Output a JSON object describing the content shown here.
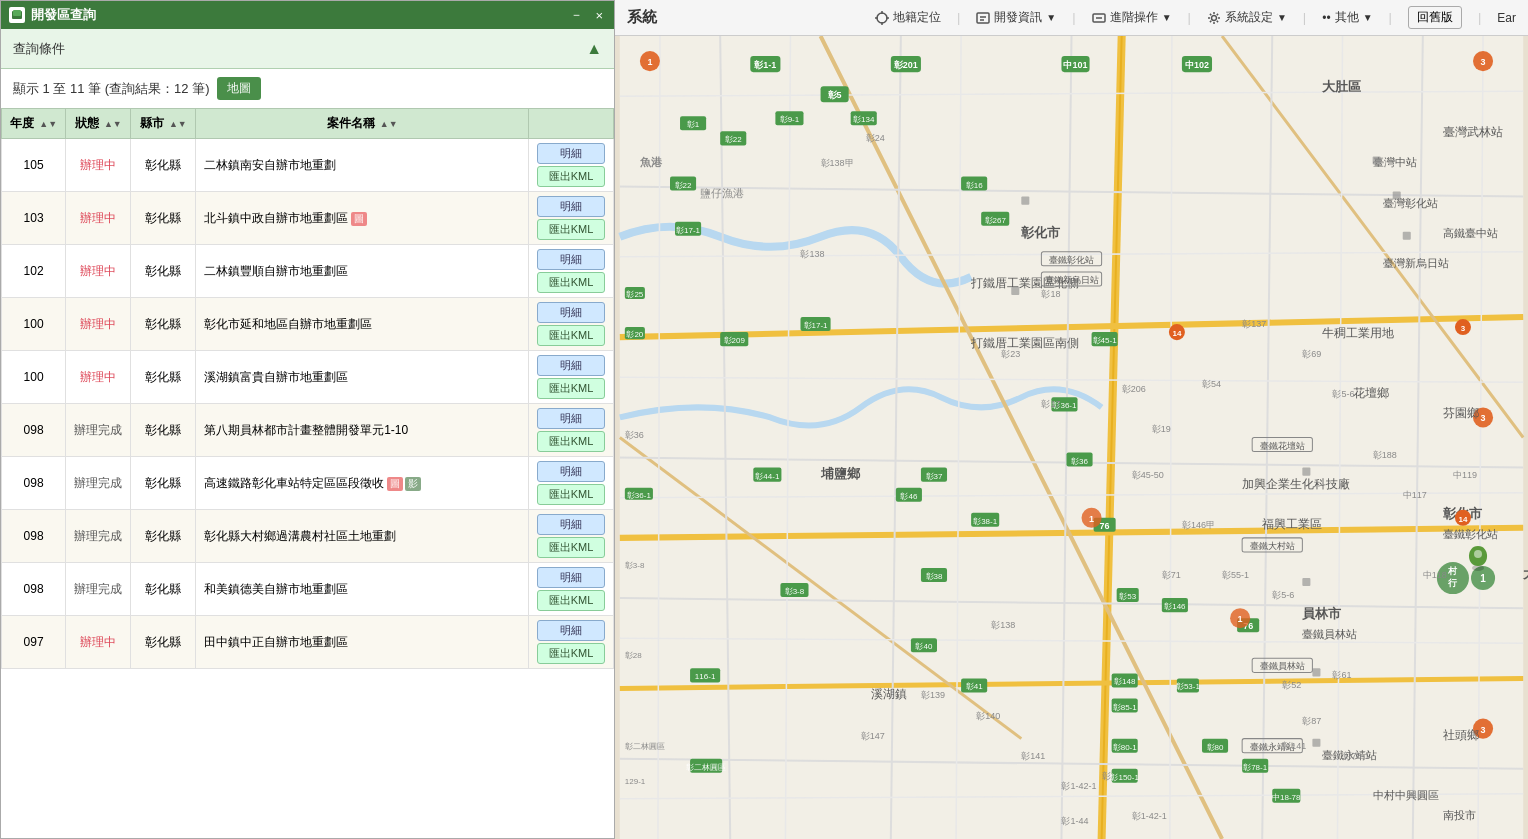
{
  "app": {
    "title": "開發區查詢",
    "minimize_label": "－",
    "close_label": "×"
  },
  "query_bar": {
    "label": "查詢條件",
    "toggle_icon": "▲"
  },
  "results": {
    "summary": "顯示 1 至 11 筆 (查詢結果：12 筆)",
    "map_btn": "地圖"
  },
  "table": {
    "headers": [
      {
        "label": "年度",
        "sortable": true
      },
      {
        "label": "狀態",
        "sortable": true
      },
      {
        "label": "縣市",
        "sortable": true
      },
      {
        "label": "案件名稱",
        "sortable": true
      }
    ],
    "rows": [
      {
        "year": "105",
        "status": "辦理中",
        "status_type": "doing",
        "county": "彰化縣",
        "name": "二林鎮南安自辦市地重劃",
        "has_badge": false,
        "badge_type": null,
        "detail_btn": "明細",
        "kml_btn": "匯出KML"
      },
      {
        "year": "103",
        "status": "辦理中",
        "status_type": "doing",
        "county": "彰化縣",
        "name": "北斗鎮中政自辦市地重劃區",
        "has_badge": true,
        "badge_type": "red",
        "detail_btn": "明細",
        "kml_btn": "匯出KML"
      },
      {
        "year": "102",
        "status": "辦理中",
        "status_type": "doing",
        "county": "彰化縣",
        "name": "二林鎮豐順自辦市地重劃區",
        "has_badge": false,
        "badge_type": null,
        "detail_btn": "明細",
        "kml_btn": "匯出KML"
      },
      {
        "year": "100",
        "status": "辦理中",
        "status_type": "doing",
        "county": "彰化縣",
        "name": "彰化市延和地區自辦市地重劃區",
        "has_badge": false,
        "badge_type": null,
        "detail_btn": "明細",
        "kml_btn": "匯出KML"
      },
      {
        "year": "100",
        "status": "辦理中",
        "status_type": "doing",
        "county": "彰化縣",
        "name": "溪湖鎮富貴自辦市地重劃區",
        "has_badge": false,
        "badge_type": null,
        "detail_btn": "明細",
        "kml_btn": "匯出KML"
      },
      {
        "year": "098",
        "status": "辦理完成",
        "status_type": "done",
        "county": "彰化縣",
        "name": "第八期員林都市計畫整體開發單元1-10",
        "has_badge": false,
        "badge_type": null,
        "detail_btn": "明細",
        "kml_btn": "匯出KML"
      },
      {
        "year": "098",
        "status": "辦理完成",
        "status_type": "done",
        "county": "彰化縣",
        "name": "高速鐵路彰化車站特定區區段徵收",
        "has_badge": true,
        "badge_type": "double",
        "detail_btn": "明細",
        "kml_btn": "匯出KML"
      },
      {
        "year": "098",
        "status": "辦理完成",
        "status_type": "done",
        "county": "彰化縣",
        "name": "彰化縣大村鄉過溝農村社區土地重劃",
        "has_badge": false,
        "badge_type": null,
        "detail_btn": "明細",
        "kml_btn": "匯出KML"
      },
      {
        "year": "098",
        "status": "辦理完成",
        "status_type": "done",
        "county": "彰化縣",
        "name": "和美鎮德美自辦市地重劃區",
        "has_badge": false,
        "badge_type": null,
        "detail_btn": "明細",
        "kml_btn": "匯出KML"
      },
      {
        "year": "097",
        "status": "辦理中",
        "status_type": "doing",
        "county": "彰化縣",
        "name": "田中鎮中正自辦市地重劃區",
        "has_badge": false,
        "badge_type": null,
        "detail_btn": "明細",
        "kml_btn": "匯出KML"
      }
    ]
  },
  "toolbar": {
    "title": "系統",
    "location_label": "地籍定位",
    "devinfo_label": "開發資訊",
    "advanced_label": "進階操作",
    "settings_label": "系統設定",
    "other_label": "其他",
    "back_label": "回舊版",
    "ear_label": "Ear"
  },
  "map": {
    "marker1_label": "村行",
    "marker2_label": "1"
  }
}
